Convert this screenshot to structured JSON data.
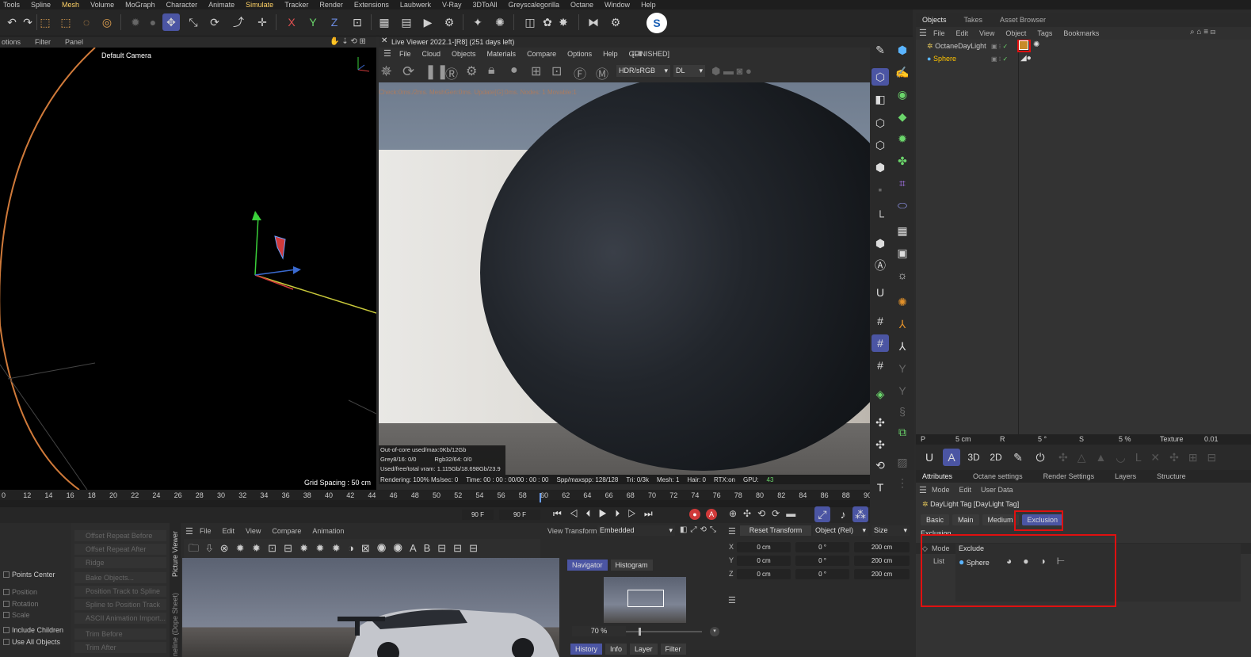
{
  "menu": [
    "Tools",
    "Spline",
    "Mesh",
    "Volume",
    "MoGraph",
    "Character",
    "Animate",
    "Simulate",
    "Tracker",
    "Render",
    "Extensions",
    "Laubwerk",
    "V-Ray",
    "3DToAll",
    "Greyscalegorilla",
    "Octane",
    "Window",
    "Help"
  ],
  "viewport": {
    "menu": [
      "otions",
      "Filter",
      "Panel"
    ],
    "camera_label": "Default Camera",
    "grid_spacing": "Grid Spacing : 50 cm"
  },
  "live_viewer": {
    "title": "Live Viewer 2022.1-[R8] (251 days left)",
    "menu": [
      "File",
      "Cloud",
      "Objects",
      "Materials",
      "Compare",
      "Options",
      "Help",
      "GUI"
    ],
    "finished": "[FINISHED]",
    "color_space": "HDR/sRGB",
    "mode": "DL",
    "overlay": "Check:0ms./2ms. MeshGen:0ms. Update[G]:0ms. Nodes: 1 Movable:1",
    "stats": {
      "out_of_core": "Out-of-core used/max:0Kb/12Gb",
      "grey": "Grey8/16: 0/0",
      "rgb": "Rgb32/64: 0/0",
      "vram": "Used/free/total vram: 1.115Gb/18.698Gb/23.9"
    },
    "status": [
      "Rendering: 100% Ms/sec: 0",
      "Time: 00 : 00 : 00/00 : 00 : 00",
      "Spp/maxspp: 128/128",
      "Tri: 0/3k",
      "Mesh: 1",
      "Hair: 0",
      "RTX:on",
      "GPU:",
      "43"
    ]
  },
  "objects": {
    "tabs": [
      "Objects",
      "Takes",
      "Asset Browser"
    ],
    "menu": [
      "File",
      "Edit",
      "View",
      "Object",
      "Tags",
      "Bookmarks"
    ],
    "items": [
      "OctaneDayLight",
      "Sphere"
    ]
  },
  "coords": {
    "p": "P",
    "p_val": "5 cm",
    "r": "R",
    "r_val": "5 °",
    "s": "S",
    "s_val": "5 %",
    "texture": "Texture",
    "tex_val": "0.01"
  },
  "attributes": {
    "tabs": [
      "Attributes",
      "Octane settings",
      "Render Settings",
      "Layers",
      "Structure"
    ],
    "menu": [
      "Mode",
      "Edit",
      "User Data"
    ],
    "title": "DayLight Tag [DayLight Tag]",
    "subtabs": [
      "Basic",
      "Main",
      "Medium",
      "Exclusion"
    ],
    "section": "Exclusion",
    "mode_label": "Mode",
    "mode_value": "Exclude",
    "list_label": "List",
    "list_item": "Sphere"
  },
  "timeline": {
    "ticks": [
      "0",
      "12",
      "14",
      "16",
      "18",
      "20",
      "22",
      "24",
      "26",
      "28",
      "30",
      "32",
      "34",
      "36",
      "38",
      "40",
      "42",
      "44",
      "46",
      "48",
      "50",
      "52",
      "54",
      "56",
      "58",
      "60",
      "62",
      "64",
      "66",
      "68",
      "70",
      "72",
      "74",
      "76",
      "78",
      "80",
      "82",
      "84",
      "86",
      "88",
      "90"
    ],
    "frame_a": "90 F",
    "frame_b": "90 F"
  },
  "picture_viewer": {
    "menu": [
      "File",
      "Edit",
      "View",
      "Compare",
      "Animation"
    ],
    "view_transform_label": "View Transform",
    "view_transform": "Embedded",
    "tabs": [
      "Navigator",
      "Histogram"
    ],
    "zoom": "70 %",
    "bottom_tabs": [
      "History",
      "Info",
      "Layer",
      "Filter"
    ],
    "side_label": "Picture Viewer",
    "side_label2": "neline (Dope Sheet)"
  },
  "anim_buttons": [
    "Offset Repeat Before",
    "Offset Repeat After",
    "Ridge",
    "Bake Objects...",
    "Position Track to Spline",
    "Spline to Position Track",
    "ASCII Animation Import...",
    "Trim Before",
    "Trim After"
  ],
  "left_checks": [
    "Points Center",
    "Position",
    "Rotation",
    "Scale",
    "Include Children",
    "Use All Objects"
  ],
  "transform": {
    "reset": "Reset Transform",
    "object_rel": "Object (Rel)",
    "size": "Size",
    "rows": [
      {
        "axis": "X",
        "pos": "0 cm",
        "rot": "0 °",
        "size": "200 cm"
      },
      {
        "axis": "Y",
        "pos": "0 cm",
        "rot": "0 °",
        "size": "200 cm"
      },
      {
        "axis": "Z",
        "pos": "0 cm",
        "rot": "0 °",
        "size": "200 cm"
      }
    ]
  },
  "colors": {
    "accent": "#4b55a3",
    "highlight_red": "#e01010",
    "sphere_label": "#ffc400"
  }
}
